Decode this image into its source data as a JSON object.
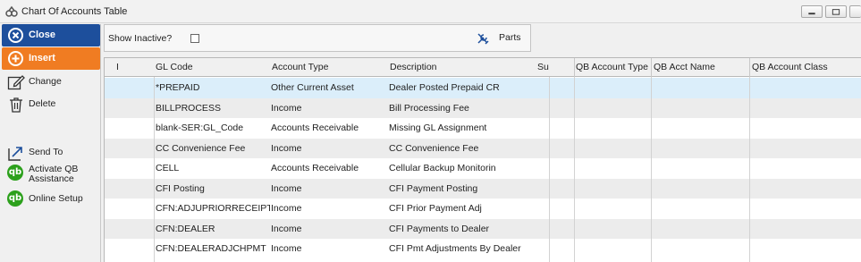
{
  "window": {
    "title": "Chart Of Accounts Table"
  },
  "sidebar": {
    "close_label": "Close",
    "insert_label": "Insert",
    "change_label": "Change",
    "delete_label": "Delete",
    "send_to_label": "Send To",
    "activate_qb_label_line1": "Activate QB",
    "activate_qb_label_line2": "Assistance",
    "online_setup_label": "Online Setup",
    "qb_glyph": "qb"
  },
  "filters": {
    "show_inactive_label": "Show Inactive?",
    "show_inactive_checked": false,
    "parts_label": "Parts"
  },
  "table": {
    "columns": {
      "indicator": "I",
      "gl_code": "GL Code",
      "account_type": "Account Type",
      "description": "Description",
      "su": "Su",
      "qb_account_type": "QB Account Type",
      "qb_acct_name": "QB Acct Name",
      "qb_account_class": "QB Account Class"
    },
    "rows": [
      {
        "gl_code": "*PREPAID",
        "account_type": "Other Current Asset",
        "description": "Dealer Posted Prepaid CR"
      },
      {
        "gl_code": "BILLPROCESS",
        "account_type": "Income",
        "description": "Bill Processing Fee"
      },
      {
        "gl_code": "blank-SER:GL_Code",
        "account_type": "Accounts Receivable",
        "description": "Missing GL Assignment"
      },
      {
        "gl_code": "CC Convenience Fee",
        "account_type": "Income",
        "description": "CC Convenience Fee"
      },
      {
        "gl_code": "CELL",
        "account_type": "Accounts Receivable",
        "description": "Cellular Backup Monitorin"
      },
      {
        "gl_code": "CFI Posting",
        "account_type": "Income",
        "description": "CFI Payment Posting"
      },
      {
        "gl_code": "CFN:ADJUPRIORRECEIPT",
        "account_type": "Income",
        "description": "CFI Prior Payment Adj"
      },
      {
        "gl_code": "CFN:DEALER",
        "account_type": "Income",
        "description": "CFI Payments to Dealer"
      },
      {
        "gl_code": "CFN:DEALERADJCHPMT",
        "account_type": "Income",
        "description": "CFI Pmt Adjustments By Dealer"
      }
    ]
  },
  "colors": {
    "close_bg": "#1d4f9c",
    "insert_bg": "#f07c22",
    "selected_row": "#dbeefa",
    "qb_green": "#2ca01c"
  }
}
